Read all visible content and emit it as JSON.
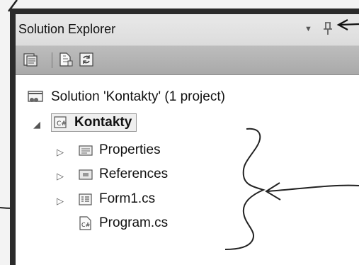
{
  "panel": {
    "title": "Solution Explorer",
    "dropdown_glyph": "▼",
    "pin_glyph": "⊥"
  },
  "toolbar": {
    "buttons": [
      {
        "icon": "properties-icon"
      },
      {
        "icon": "show-all-files-icon"
      },
      {
        "icon": "refresh-icon"
      }
    ]
  },
  "tree": {
    "solution": "Solution 'Kontakty' (1 project)",
    "project": "Kontakty",
    "expander_open": "◢",
    "expander_closed": "▷",
    "items": [
      {
        "label": "Properties"
      },
      {
        "label": "References"
      },
      {
        "label": "Form1.cs"
      },
      {
        "label": "Program.cs"
      }
    ]
  }
}
